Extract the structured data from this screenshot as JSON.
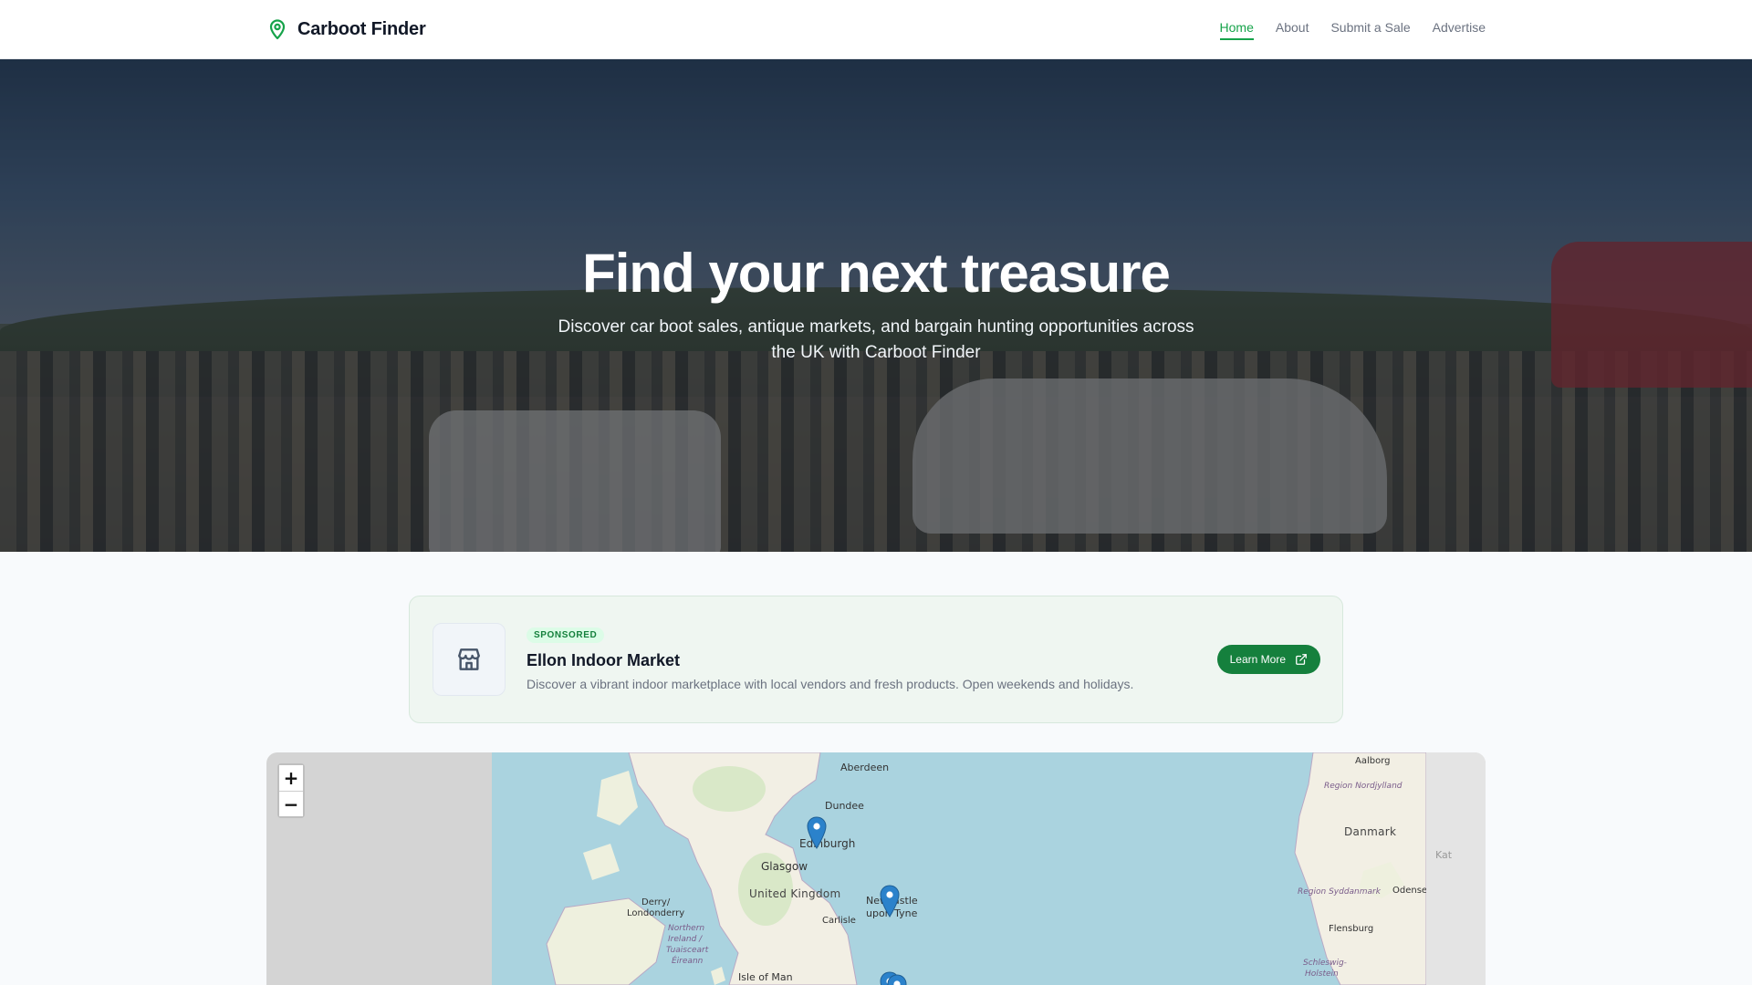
{
  "header": {
    "brand": "Carboot Finder",
    "nav": [
      {
        "label": "Home",
        "active": true
      },
      {
        "label": "About",
        "active": false
      },
      {
        "label": "Submit a Sale",
        "active": false
      },
      {
        "label": "Advertise",
        "active": false
      }
    ],
    "accent_color": "#16a34a"
  },
  "hero": {
    "title": "Find your next treasure",
    "subtitle": "Discover car boot sales, antique markets, and bargain hunting opportunities across the UK with Carboot Finder"
  },
  "sponsored": {
    "badge": "SPONSORED",
    "title": "Ellon Indoor Market",
    "description": "Discover a vibrant indoor marketplace with local vendors and fresh products. Open weekends and holidays.",
    "button_label": "Learn More",
    "icon": "store-icon"
  },
  "map": {
    "zoom_in": "+",
    "zoom_out": "−",
    "places": {
      "aberdeen": "Aberdeen",
      "dundee": "Dundee",
      "edinburgh": "Edinburgh",
      "glasgow": "Glasgow",
      "united_kingdom": "United Kingdom",
      "newcastle_1": "Newcastle",
      "newcastle_2": "upon Tyne",
      "carlisle": "Carlisle",
      "derry_1": "Derry/",
      "derry_2": "Londonderry",
      "ni_1": "Northern",
      "ni_2": "Ireland /",
      "ni_3": "Tuaisceart",
      "ni_4": "Éireann",
      "isle_of_man": "Isle of Man",
      "aalborg": "Aalborg",
      "region_nordjylland": "Region Nordjylland",
      "danmark": "Danmark",
      "region_syddanmark": "Region Syddanmark",
      "odense": "Odense",
      "flensburg": "Flensburg",
      "schleswig_1": "Schleswig-",
      "schleswig_2": "Holstein",
      "kat": "Kat"
    },
    "marker_color": "#2b82cb"
  }
}
